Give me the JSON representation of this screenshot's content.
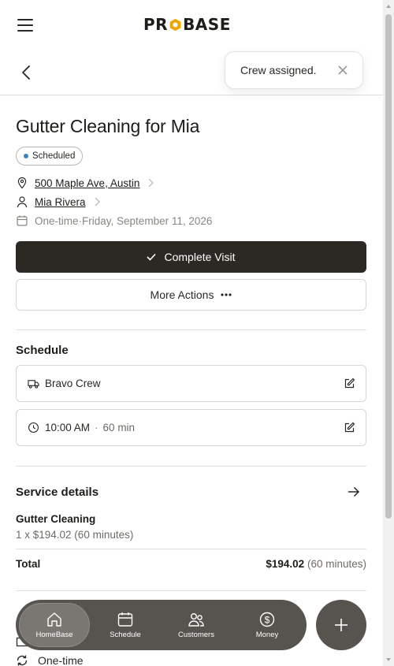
{
  "header": {
    "brand_left": "PR",
    "brand_right": "BASE"
  },
  "toast": {
    "message": "Crew assigned."
  },
  "visit": {
    "title": "Gutter Cleaning for Mia",
    "status": "Scheduled",
    "status_color": "#3b82c4",
    "address": "500 Maple Ave, Austin",
    "customer": "Mia Rivera",
    "frequency": "One-time",
    "separator": "·",
    "date": "Friday, September 11, 2026"
  },
  "actions": {
    "complete_label": "Complete Visit",
    "more_label": "More Actions"
  },
  "schedule": {
    "title": "Schedule",
    "crew": "Bravo Crew",
    "time": "10:00 AM",
    "separator": "·",
    "duration": "60 min"
  },
  "service": {
    "title": "Service details",
    "name": "Gutter Cleaning",
    "line": "1 x $194.02 (60 minutes)",
    "total_label": "Total",
    "total_amount": "$194.02",
    "total_duration": "(60 minutes)"
  },
  "peek": {
    "recurrence": "One-time"
  },
  "nav": {
    "items": [
      {
        "label": "HomeBase",
        "icon": "home-icon"
      },
      {
        "label": "Schedule",
        "icon": "calendar-icon"
      },
      {
        "label": "Customers",
        "icon": "users-icon"
      },
      {
        "label": "Money",
        "icon": "dollar-icon"
      }
    ],
    "fab_icon": "plus-icon"
  },
  "colors": {
    "primary_button": "#2c2925",
    "navbar": "#57544f",
    "brand_accent": "#f0a400"
  }
}
